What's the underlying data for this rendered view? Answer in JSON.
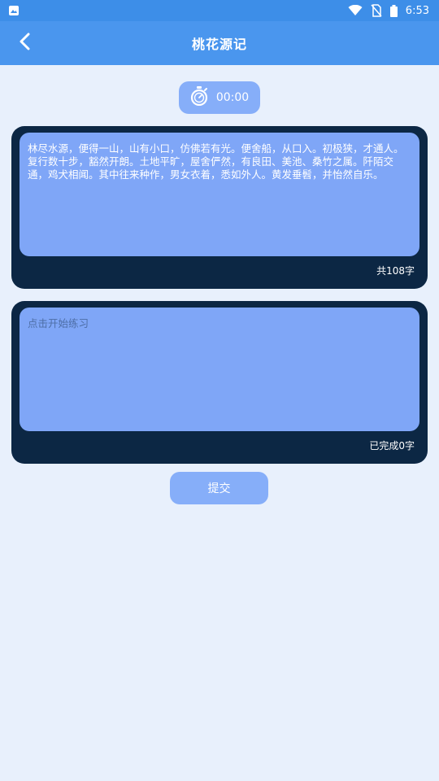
{
  "status_bar": {
    "time": "6:53"
  },
  "header": {
    "title": "桃花源记"
  },
  "timer": {
    "value": "00:00"
  },
  "source_text": {
    "content": "林尽水源，便得一山，山有小口，仿佛若有光。便舍船，从口入。初极狭，才通人。复行数十步，豁然开朗。土地平旷，屋舍俨然，有良田、美池、桑竹之属。阡陌交通，鸡犬相闻。其中往来种作，男女衣着，悉如外人。黄发垂髫，并怡然自乐。",
    "count_label": "共108字"
  },
  "practice": {
    "placeholder": "点击开始练习",
    "value": "",
    "count_label": "已完成0字"
  },
  "actions": {
    "submit_label": "提交"
  },
  "colors": {
    "status_bar": "#3d8ee8",
    "app_bar": "#4a96ee",
    "background": "#e8f0fc",
    "card_dark": "#0c2744",
    "card_light": "#7fa6f7",
    "button": "#86aef9"
  }
}
